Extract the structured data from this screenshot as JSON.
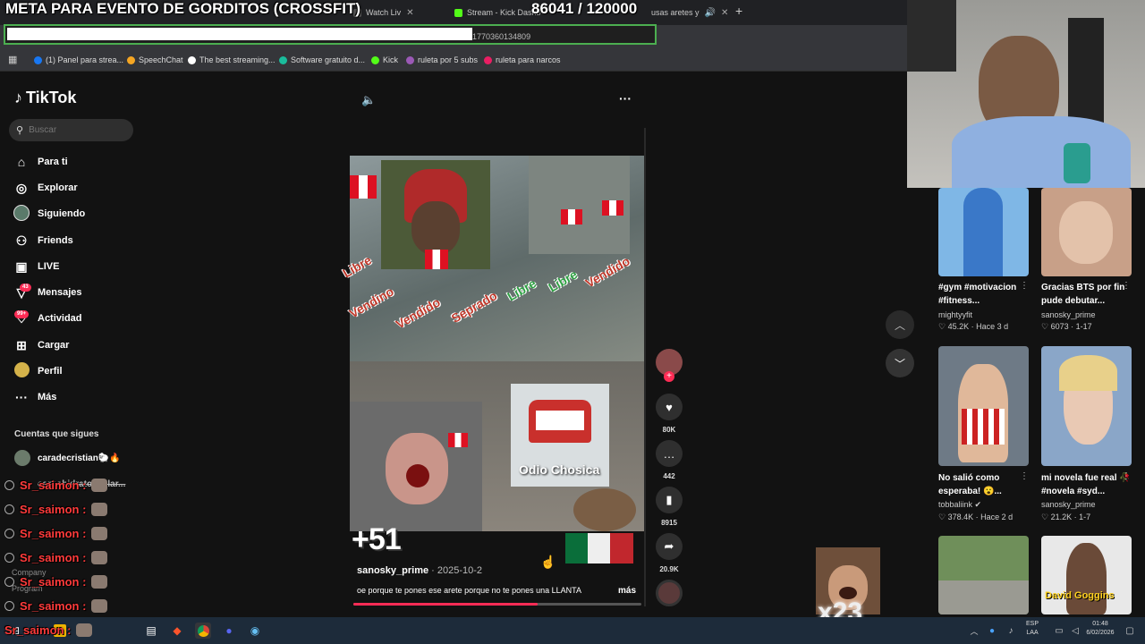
{
  "overlay": {
    "meta_title": "META PARA EVENTO DE GORDITOS (CROSSFIT)",
    "counter": "86041  / 120000",
    "multiplier": "x23"
  },
  "browser": {
    "tabs": [
      {
        "label": "Watch Liv"
      },
      {
        "label": "Stream - Kick Dashb"
      },
      {
        "label": "usas aretes y"
      }
    ],
    "new_tab": "+",
    "url_tail": "1770360134809",
    "bookmarks": [
      {
        "label": "(1) Panel para strea...",
        "color": "#1877f2"
      },
      {
        "label": "SpeechChat",
        "color": "#f5a623"
      },
      {
        "label": "The best streaming...",
        "color": "#ffffff"
      },
      {
        "label": "Software gratuito d...",
        "color": "#1abc9c"
      },
      {
        "label": "Kick",
        "color": "#53fc18"
      },
      {
        "label": "ruleta por 5 subs",
        "color": "#9b59b6"
      },
      {
        "label": "ruleta para narcos",
        "color": "#e91e63"
      }
    ]
  },
  "tiktok": {
    "logo": "TikTok",
    "search_placeholder": "Buscar",
    "nav": [
      {
        "icon": "home-icon",
        "glyph": "⌂",
        "label": "Para ti"
      },
      {
        "icon": "compass-icon",
        "glyph": "◎",
        "label": "Explorar"
      },
      {
        "icon": "following-avatar",
        "glyph": "●",
        "label": "Siguiendo"
      },
      {
        "icon": "friends-icon",
        "glyph": "⚇",
        "label": "Friends"
      },
      {
        "icon": "live-icon",
        "glyph": "▣",
        "label": "LIVE"
      },
      {
        "icon": "messages-icon",
        "glyph": "▽",
        "label": "Mensajes",
        "badge": "43"
      },
      {
        "icon": "activity-icon",
        "glyph": "♡",
        "label": "Actividad",
        "badge": "99+"
      },
      {
        "icon": "upload-icon",
        "glyph": "⊞",
        "label": "Cargar"
      },
      {
        "icon": "profile-avatar",
        "glyph": "●",
        "label": "Perfil"
      },
      {
        "icon": "more-icon",
        "glyph": "···",
        "label": "Más"
      }
    ],
    "following_header": "Cuentas que sigues",
    "following": [
      "caradecristian🐑🔥",
      "carbohidratosenlar..."
    ],
    "chat": [
      {
        "user": "Sr_saimon :"
      },
      {
        "user": "Sr_saimon :"
      },
      {
        "user": "Sr_saimon :"
      },
      {
        "user": "Sr_saimon :"
      },
      {
        "user": "Sr_saimon :"
      },
      {
        "user": "Sr_saimon :"
      },
      {
        "user": "Sr_saimon :"
      }
    ],
    "ghost_labels": [
      "Company",
      "Program"
    ],
    "video": {
      "overlay_words": [
        "Libre",
        "Vendino",
        "Vendido",
        "Seprado",
        "Libre",
        "Libre",
        "Vendido"
      ],
      "odio": "Odio Chosica",
      "plus": "+51",
      "author": "sanosky_prime",
      "date": "· 2025-10-2",
      "caption": "oe porque te pones ese arete porque no te pones una LLANTA",
      "more": "más",
      "progress": 0.64
    },
    "actions": [
      {
        "name": "like-icon",
        "glyph": "♥",
        "count": "80K"
      },
      {
        "name": "comment-icon",
        "glyph": "…",
        "count": "442"
      },
      {
        "name": "bookmark-icon",
        "glyph": "▮",
        "count": "8915"
      },
      {
        "name": "share-icon",
        "glyph": "➦",
        "count": "20.9K"
      }
    ],
    "recommended": [
      {
        "title": "#gym #motivacion #fitness...",
        "user": "mightyyfit",
        "stats": "♡ 45.2K · Hace 3 d",
        "color": "#7fb7e6"
      },
      {
        "title": "Gracias BTS por fin pude debutar...",
        "user": "sanosky_prime",
        "stats": "♡ 6073 · 1-17",
        "color": "#c8a088"
      },
      {
        "title": "No salió como esperaba! 😮...",
        "user": "tobbaliink ✔",
        "stats": "♡ 378.4K · Hace 2 d",
        "color": "#d9b7a0"
      },
      {
        "title": "mi novela fue real 🥀 #novela #syd...",
        "user": "sanosky_prime",
        "stats": "♡ 21.2K · 1-7",
        "color": "#8aa6c8"
      },
      {
        "title": "",
        "user": "",
        "stats": "",
        "color": "#6f8f5a"
      },
      {
        "title": "David Goggins",
        "user": "",
        "stats": "",
        "color": "#e8e8e8"
      }
    ]
  },
  "taskbar": {
    "lang": "ESP",
    "lang2": "LAA",
    "time": "01:48",
    "date": "6/02/2026"
  }
}
